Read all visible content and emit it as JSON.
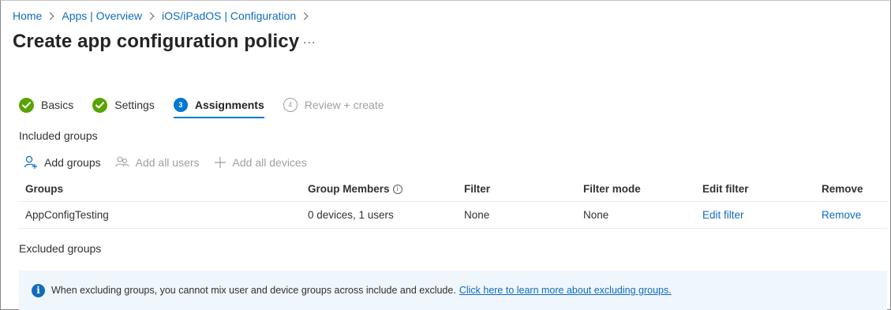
{
  "breadcrumb": [
    "Home",
    "Apps | Overview",
    "iOS/iPadOS | Configuration"
  ],
  "page": {
    "title": "Create app configuration policy",
    "more": "..."
  },
  "steps": [
    {
      "label": "Basics",
      "status": "complete"
    },
    {
      "label": "Settings",
      "status": "complete"
    },
    {
      "label": "Assignments",
      "status": "active",
      "number": "3"
    },
    {
      "label": "Review + create",
      "status": "disabled",
      "number": "4"
    }
  ],
  "included": {
    "title": "Included groups",
    "toolbar": {
      "add_groups": "Add groups",
      "add_all_users": "Add all users",
      "add_all_devices": "Add all devices"
    },
    "columns": [
      "Groups",
      "Group Members",
      "Filter",
      "Filter mode",
      "Edit filter",
      "Remove"
    ],
    "info_glyph": "i",
    "rows": [
      {
        "group": "AppConfigTesting",
        "members": "0 devices, 1 users",
        "filter": "None",
        "filter_mode": "None",
        "edit": "Edit filter",
        "remove": "Remove"
      }
    ]
  },
  "excluded": {
    "title": "Excluded groups"
  },
  "banner": {
    "icon": "i",
    "text": "When excluding groups, you cannot mix user and device groups across include and exclude.",
    "link": "Click here to learn more about excluding groups."
  },
  "colors": {
    "accent": "#0078d4",
    "link": "#0f6cbd",
    "success": "#57a300",
    "banner_bg": "#eff6fc"
  }
}
